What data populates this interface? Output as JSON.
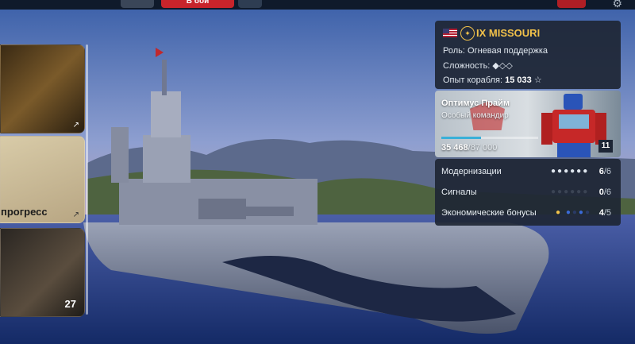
{
  "topbar": {
    "battle_label": "В бой"
  },
  "left_cards": [
    {
      "id": "card-1",
      "text": "",
      "count": ""
    },
    {
      "id": "card-2",
      "text": "прогресс",
      "count": ""
    },
    {
      "id": "card-3",
      "text": "",
      "count": "27"
    }
  ],
  "ship": {
    "tier_name": "IX MISSOURI",
    "role_label": "Роль:",
    "role_value": "Огневая поддержка",
    "difficulty_label": "Сложность:",
    "difficulty_value": "◆◇◇",
    "xp_label": "Опыт корабля:",
    "xp_value": "15 033"
  },
  "commander": {
    "name": "Оптимус Прайм",
    "subtitle": "Особый командир",
    "xp_current": "35 468",
    "xp_total": "/87 000",
    "level": "11",
    "progress": 0.41
  },
  "stats": [
    {
      "label": "Модернизации",
      "dots": "●●●●●●",
      "value_current": "6",
      "value_total": "/6"
    },
    {
      "label": "Сигналы",
      "dots": "●●●●●●",
      "value_current": "0",
      "value_total": "/6"
    },
    {
      "label": "Экономические бонусы",
      "dots": "●  ●●●●",
      "value_current": "4",
      "value_total": "/5"
    }
  ],
  "colors": {
    "accent_gold": "#f2c24a",
    "battle_red": "#c8242b",
    "panel_bg": "#1e2634",
    "progress_blue": "#3ab0d8"
  }
}
